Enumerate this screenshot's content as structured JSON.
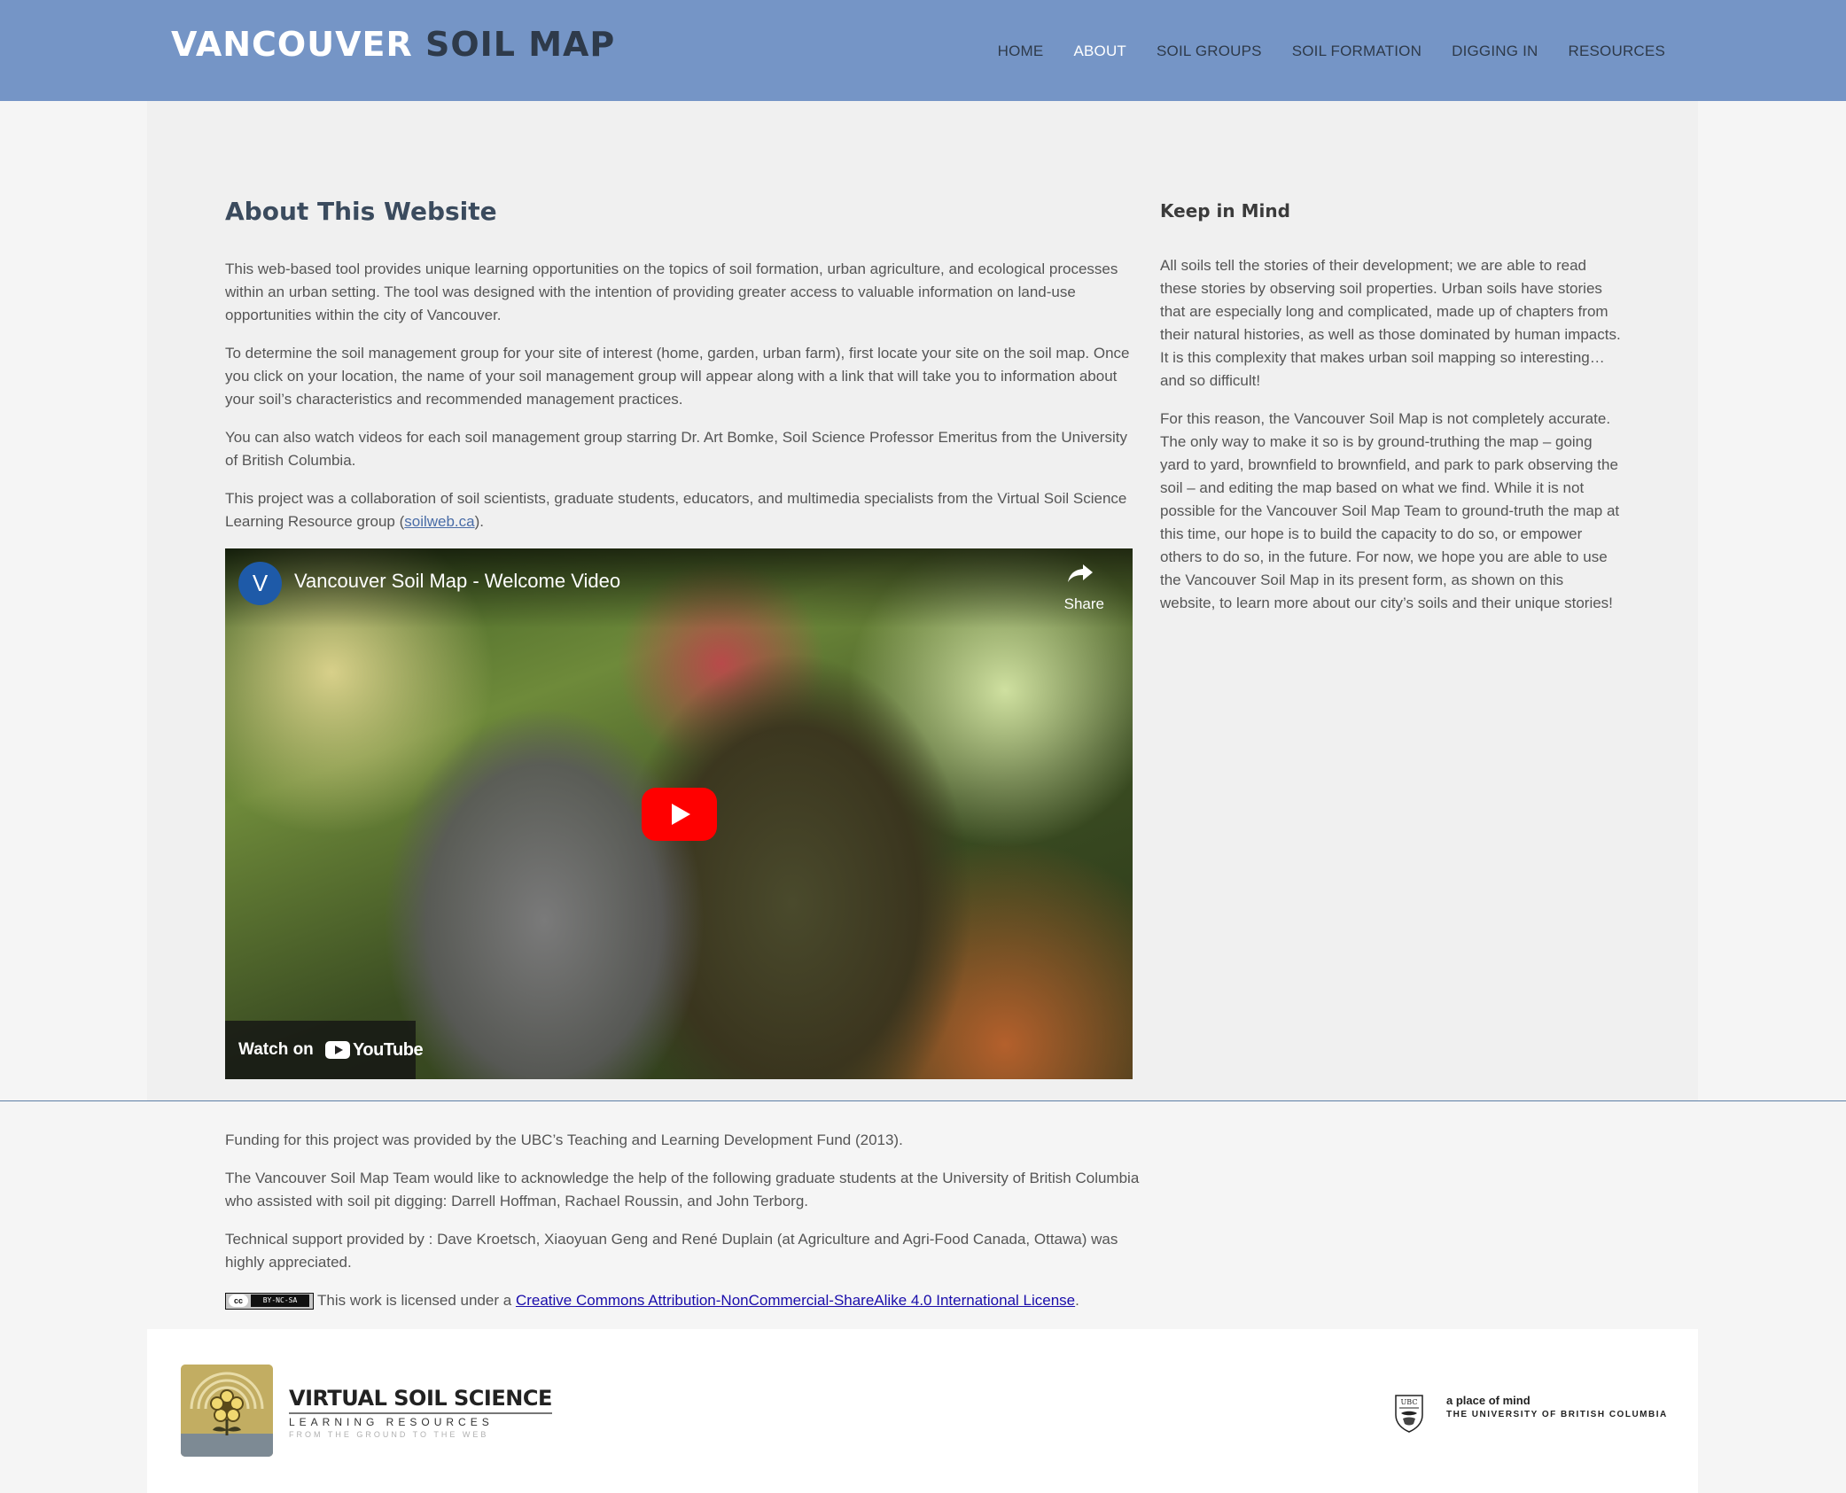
{
  "header": {
    "logo_word1": "VANCOUVER",
    "logo_word2": "SOIL MAP",
    "nav": [
      {
        "label": "HOME"
      },
      {
        "label": "ABOUT"
      },
      {
        "label": "SOIL GROUPS"
      },
      {
        "label": "SOIL FORMATION"
      },
      {
        "label": "DIGGING IN"
      },
      {
        "label": "RESOURCES"
      }
    ],
    "active_nav": "ABOUT"
  },
  "main": {
    "title": "About This Website",
    "p1": "This web-based tool provides unique learning opportunities on the topics of soil formation, urban agriculture, and ecological processes within an urban setting. The tool was designed with the intention of providing greater access to valuable information on land-use opportunities within the city of Vancouver.",
    "p2": "To determine the soil management group for your site of interest (home, garden, urban farm), first locate your site on the soil map. Once you click on your location, the name of your soil management group will appear along with a link that will take you to information about your soil’s characteristics and recommended management practices.",
    "p3": "You can also watch videos for each soil management group starring Dr. Art Bomke, Soil Science Professor Emeritus from the University of British Columbia.",
    "p4_before": "This project was a collaboration of soil scientists, graduate students, educators, and multimedia specialists from the Virtual Soil Science Learning Resource group (",
    "p4_link": "soilweb.ca",
    "p4_after": ")."
  },
  "video": {
    "channel_initial": "V",
    "title": "Vancouver Soil Map - Welcome Video",
    "share_label": "Share",
    "watch_on": "Watch on",
    "youtube_word": "YouTube"
  },
  "sidebar": {
    "title": "Keep in Mind",
    "p1": "All soils tell the stories of their development; we are able to read these stories by observing soil properties. Urban soils have stories that are especially long and complicated, made up of chapters from their natural histories, as well as those dominated by human impacts. It is this complexity that makes urban soil mapping so interesting… and so difficult!",
    "p2": "For this reason, the Vancouver Soil Map is not completely accurate. The only way to make it so is by ground-truthing the map – going yard to yard, brownfield to brownfield, and park to park observing the soil – and editing the map based on what we find. While it is not possible for the Vancouver Soil Map Team to ground-truth the map at this time, our hope is to build the capacity to do so, or empower others to do so, in the future. For now, we hope you are able to use the Vancouver Soil Map in its present form, as shown on this website, to learn more about our city’s soils and their unique stories!"
  },
  "credits": {
    "funding": "Funding for this project was provided by the UBC’s Teaching and Learning Development Fund (2013).",
    "acknowledge": "The Vancouver Soil Map Team would like to acknowledge the help of the following graduate students at the University of British Columbia who assisted with soil pit digging: Darrell Hoffman, Rachael Roussin, and John Terborg.",
    "technical": "Technical support provided by : Dave Kroetsch, Xiaoyuan Geng and René Duplain (at Agriculture and Agri-Food Canada, Ottawa) was highly appreciated.",
    "cc_badge_left": "cc",
    "cc_badge_right": "BY-NC-SA",
    "license_before": "This work is licensed under a ",
    "license_link": "Creative Commons Attribution-NonCommercial-ShareAlike 4.0 International License",
    "license_after": "."
  },
  "footer": {
    "vss_line1": "VIRTUAL SOIL SCIENCE",
    "vss_line2": "LEARNING RESOURCES",
    "vss_line3": "FROM THE GROUND TO THE WEB",
    "ubc_crest_text": "UBC",
    "ubc_line1": "a place of mind",
    "ubc_line2": "THE UNIVERSITY OF BRITISH COLUMBIA"
  },
  "colors": {
    "header_bg": "#7595c6",
    "panel_bg": "#f0f0f0",
    "youtube_red": "#ff0000",
    "link": "#4a6da7"
  }
}
